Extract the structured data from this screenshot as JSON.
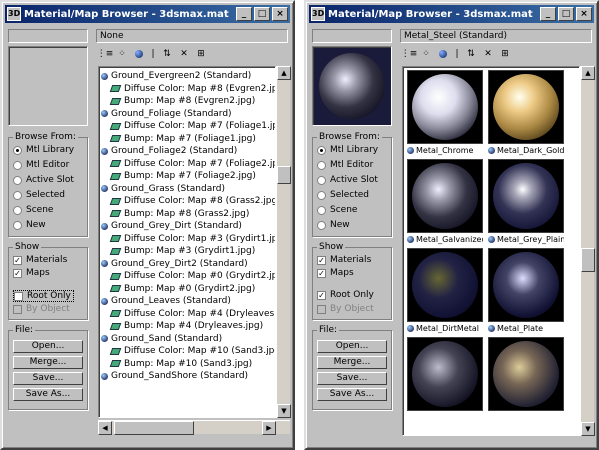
{
  "left": {
    "title": "Material/Map Browser - 3dsmax.mat",
    "name_field": "None",
    "browse_from": {
      "title": "Browse From:",
      "options": [
        {
          "label": "Mtl Library",
          "selected": true
        },
        {
          "label": "Mtl Editor",
          "selected": false
        },
        {
          "label": "Active Slot",
          "selected": false
        },
        {
          "label": "Selected",
          "selected": false
        },
        {
          "label": "Scene",
          "selected": false
        },
        {
          "label": "New",
          "selected": false
        }
      ]
    },
    "show": {
      "title": "Show",
      "materials": {
        "label": "Materials",
        "checked": true
      },
      "maps": {
        "label": "Maps",
        "checked": true
      },
      "root_only": {
        "label": "Root Only",
        "checked": false
      },
      "by_object": {
        "label": "By Object",
        "checked": false
      }
    },
    "file": {
      "title": "File:",
      "buttons": [
        "Open...",
        "Merge...",
        "Save...",
        "Save As..."
      ]
    },
    "tree": [
      {
        "kind": "mat",
        "text": "Ground_Evergreen2 (Standard)"
      },
      {
        "kind": "map",
        "text": "Diffuse Color: Map #8 (Evgren2.jpg)"
      },
      {
        "kind": "map",
        "text": "Bump: Map #8 (Evgren2.jpg)"
      },
      {
        "kind": "mat",
        "text": "Ground_Foliage (Standard)"
      },
      {
        "kind": "map",
        "text": "Diffuse Color: Map #7 (Foliage1.jpg)"
      },
      {
        "kind": "map",
        "text": "Bump: Map #7 (Foliage1.jpg)"
      },
      {
        "kind": "mat",
        "text": "Ground_Foliage2 (Standard)"
      },
      {
        "kind": "map",
        "text": "Diffuse Color: Map #7 (Foliage2.jpg)"
      },
      {
        "kind": "map",
        "text": "Bump: Map #7 (Foliage2.jpg)"
      },
      {
        "kind": "mat",
        "text": "Ground_Grass (Standard)"
      },
      {
        "kind": "map",
        "text": "Diffuse Color: Map #8 (Grass2.jpg)"
      },
      {
        "kind": "map",
        "text": "Bump: Map #8 (Grass2.jpg)"
      },
      {
        "kind": "mat",
        "text": "Ground_Grey_Dirt (Standard)"
      },
      {
        "kind": "map",
        "text": "Diffuse Color: Map #3 (Grydirt1.jpg)"
      },
      {
        "kind": "map",
        "text": "Bump: Map #3 (Grydirt1.jpg)"
      },
      {
        "kind": "mat",
        "text": "Ground_Grey_Dirt2 (Standard)"
      },
      {
        "kind": "map",
        "text": "Diffuse Color: Map #0 (Grydirt2.jpg)"
      },
      {
        "kind": "map",
        "text": "Bump: Map #0 (Grydirt2.jpg)"
      },
      {
        "kind": "mat",
        "text": "Ground_Leaves (Standard)"
      },
      {
        "kind": "map",
        "text": "Diffuse Color: Map #4 (Dryleaves.jpg)"
      },
      {
        "kind": "map",
        "text": "Bump: Map #4 (Dryleaves.jpg)"
      },
      {
        "kind": "mat",
        "text": "Ground_Sand (Standard)"
      },
      {
        "kind": "map",
        "text": "Diffuse Color: Map #10 (Sand3.jpg)"
      },
      {
        "kind": "map",
        "text": "Bump: Map #10 (Sand3.jpg)"
      },
      {
        "kind": "mat",
        "text": "Ground_SandShore (Standard)"
      }
    ]
  },
  "right": {
    "title": "Material/Map Browser - 3dsmax.mat",
    "name_field": "Metal_Steel (Standard)",
    "browse_from": {
      "title": "Browse From:",
      "options": [
        {
          "label": "Mtl Library",
          "selected": true
        },
        {
          "label": "Mtl Editor",
          "selected": false
        },
        {
          "label": "Active Slot",
          "selected": false
        },
        {
          "label": "Selected",
          "selected": false
        },
        {
          "label": "Scene",
          "selected": false
        },
        {
          "label": "New",
          "selected": false
        }
      ]
    },
    "show": {
      "title": "Show",
      "materials": {
        "label": "Materials",
        "checked": true
      },
      "maps": {
        "label": "Maps",
        "checked": true
      },
      "root_only": {
        "label": "Root Only",
        "checked": true
      },
      "by_object": {
        "label": "By Object",
        "checked": false
      }
    },
    "file": {
      "title": "File:",
      "buttons": [
        "Open...",
        "Merge...",
        "Save...",
        "Save As..."
      ]
    },
    "thumbs": [
      {
        "label": "Metal_Chrome",
        "style": "radial-gradient(circle at 40% 35%,#fff 0%,#dde 30%,#889 55%,#223 80%,#000 100%)"
      },
      {
        "label": "Metal_Dark_Gold",
        "style": "radial-gradient(circle at 40% 35%,#ffe 0%,#ec8 25%,#a84 55%,#431 85%,#100 100%)"
      },
      {
        "label": "Metal_Galvanized",
        "style": "radial-gradient(circle at 40% 40%,#eef 0%,#99a 20%,#334 50%,#112 80%,#000 100%)"
      },
      {
        "label": "Metal_Grey_Plain",
        "style": "radial-gradient(circle at 45% 40%,#fff 0%,#aab 15%,#335 45%,#113 80%,#000 100%)"
      },
      {
        "label": "Metal_DirtMetal",
        "style": "radial-gradient(circle at 40% 40%,#663 0%,#224 35%,#113 70%,#000 100%)"
      },
      {
        "label": "Metal_Plate",
        "style": "radial-gradient(circle at 45% 40%,#ddf 0%,#446 30%,#113 70%,#000 100%)"
      },
      {
        "label": "",
        "style": "radial-gradient(circle at 40% 40%,#bbc 0%,#445 35%,#112 75%,#000 100%)"
      },
      {
        "label": "",
        "style": "radial-gradient(circle at 40% 40%,#dc9 0%,#765 30%,#223 70%,#000 100%)"
      }
    ]
  },
  "icons": {
    "title_app": "3D",
    "minimize": "_",
    "maximize": "□",
    "close": "×",
    "scroll_up": "▲",
    "scroll_down": "▼",
    "scroll_left": "◀",
    "scroll_right": "▶",
    "view_list": "≡",
    "view_list_icons": "⋮≡",
    "view_small_icons": "⁘",
    "view_large_icons": "●",
    "update_scene": "⇅",
    "delete": "✕",
    "clear": "⊞"
  }
}
